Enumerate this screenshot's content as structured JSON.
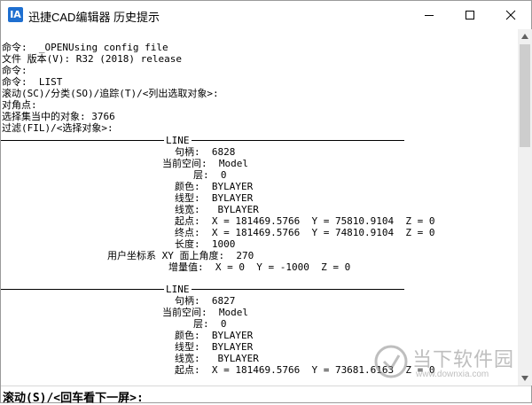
{
  "window": {
    "app_icon": "IA",
    "title": "迅捷CAD编辑器 历史提示",
    "icons": {
      "minimize": "minimize-icon",
      "maximize": "maximize-icon",
      "close": "close-icon"
    }
  },
  "history": [
    "命令:  _OPENUsing config file",
    "文件 版本(V): R32 (2018) release",
    "命令:",
    "命令:  LIST",
    "滚动(SC)/分类(SO)/追踪(T)/<列出选取对象>:",
    "对角点:",
    "选择集当中的对象: 3766",
    "过滤(FIL)/<选择对象>:"
  ],
  "entities": [
    {
      "label": "LINE",
      "rows": [
        "句柄:  6828",
        "当前空间:  Model",
        "层:  0",
        "颜色:  BYLAYER",
        "线型:  BYLAYER",
        "线宽:   BYLAYER",
        "起点:  X = 181469.5766  Y = 75810.9104  Z = 0",
        "终点:  X = 181469.5766  Y = 74810.9104  Z = 0",
        "长度:  1000",
        "用户坐标系 XY 面上角度:  270",
        "增量值:  X = 0  Y = -1000  Z = 0"
      ]
    },
    {
      "label": "LINE",
      "rows": [
        "句柄:  6827",
        "当前空间:  Model",
        "层:  0",
        "颜色:  BYLAYER",
        "线型:  BYLAYER",
        "线宽:   BYLAYER",
        "起点:  X = 181469.5766  Y = 73681.6163  Z = 0"
      ]
    }
  ],
  "prompt": "滚动(S)/<回车看下一屏>:",
  "watermark": {
    "main": "当下软件园",
    "sub": "www.downxia.com"
  }
}
